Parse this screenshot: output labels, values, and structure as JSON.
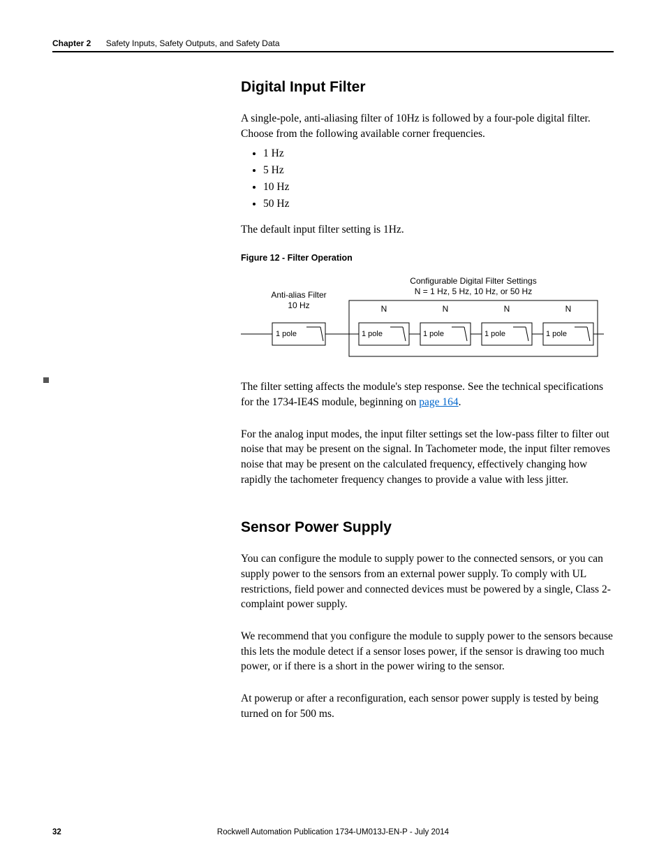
{
  "header": {
    "chapterLabel": "Chapter 2",
    "chapterTitle": "Safety Inputs, Safety Outputs, and Safety Data"
  },
  "section1": {
    "heading": "Digital Input Filter",
    "para1": "A single-pole, anti-aliasing filter of 10Hz is followed by a four-pole digital filter. Choose from the following available corner frequencies.",
    "freqs": [
      "1 Hz",
      "5 Hz",
      "10 Hz",
      "50 Hz"
    ],
    "para2": "The default input filter setting is 1Hz.",
    "figCaption": "Figure 12 - Filter Operation",
    "figure": {
      "antiAliasTitle": "Anti-alias Filter",
      "antiAliasSub": "10 Hz",
      "digitalTitle": "Configurable Digital Filter Settings",
      "digitalSub": "N = 1 Hz, 5 Hz, 10 Hz, or 50 Hz",
      "topLabels": [
        "N",
        "N",
        "N",
        "N"
      ],
      "blockLabels": [
        "1 pole",
        "1 pole",
        "1 pole",
        "1 pole",
        "1 pole"
      ]
    },
    "para3a": "The filter setting affects the module's step response. See the technical specifications for the 1734-IE4S module, beginning on ",
    "para3link": "page 164",
    "para3b": ".",
    "para4": "For the analog input modes, the input filter settings set the low-pass filter to filter out noise that may be present on the signal. In Tachometer mode, the input filter removes noise that may be present on the calculated frequency, effectively changing how rapidly the tachometer frequency changes to provide a value with less jitter."
  },
  "section2": {
    "heading": "Sensor Power Supply",
    "para1": "You can configure the module to supply power to the connected sensors, or you can supply power to the sensors from an external power supply. To comply with UL restrictions, field power and connected devices must be powered by a single, Class 2-complaint power supply.",
    "para2": "We recommend that you configure the module to supply power to the sensors because this lets the module detect if a sensor loses power, if the sensor is drawing too much power, or if there is a short in the power wiring to the sensor.",
    "para3": "At powerup or after a reconfiguration, each sensor power supply is tested by being turned on for 500 ms."
  },
  "footer": {
    "pageNumber": "32",
    "publication": "Rockwell Automation Publication 1734-UM013J-EN-P - July 2014"
  }
}
